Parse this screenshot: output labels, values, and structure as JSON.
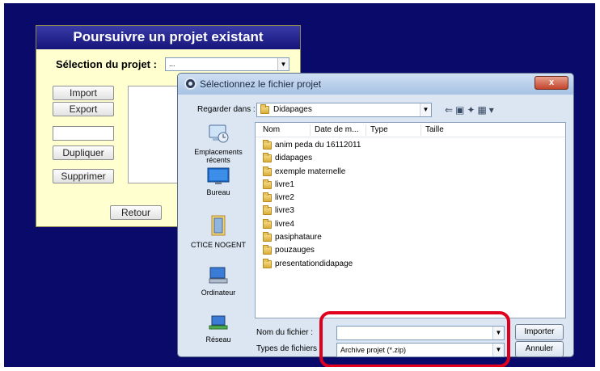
{
  "back_window": {
    "title": "Poursuivre un projet existant",
    "selection_label": "Sélection du projet :",
    "selection_value": "...",
    "buttons": {
      "import": "Import",
      "export": "Export",
      "duplicate": "Dupliquer",
      "delete": "Supprimer",
      "back": "Retour"
    }
  },
  "dialog": {
    "title": "Sélectionnez le fichier projet",
    "close_label": "x",
    "look_in_label": "Regarder dans :",
    "look_in_value": "Didapages",
    "places": [
      {
        "label": "Emplacements récents",
        "icon": "recent-places-icon"
      },
      {
        "label": "Bureau",
        "icon": "desktop-icon"
      },
      {
        "label": "CTICE NOGENT",
        "icon": "user-folder-icon"
      },
      {
        "label": "Ordinateur",
        "icon": "computer-icon"
      },
      {
        "label": "Réseau",
        "icon": "network-icon"
      }
    ],
    "columns": [
      "Nom",
      "Date de m...",
      "Type",
      "Taille"
    ],
    "files": [
      "anim peda du 16112011",
      "didapages",
      "exemple maternelle",
      "livre1",
      "livre2",
      "livre3",
      "livre4",
      "pasiphataure",
      "pouzauges",
      "presentationdidapage"
    ],
    "filename_label": "Nom du fichier :",
    "filename_value": "",
    "filetype_label": "Types de fichiers :",
    "filetype_value": "Archive projet (*.zip)",
    "import_button": "Importer",
    "cancel_button": "Annuler"
  },
  "colors": {
    "background": "#0a0a6a",
    "back_window": "#ffffd0",
    "title_bar": "#15157a",
    "highlight": "#e0001e"
  }
}
